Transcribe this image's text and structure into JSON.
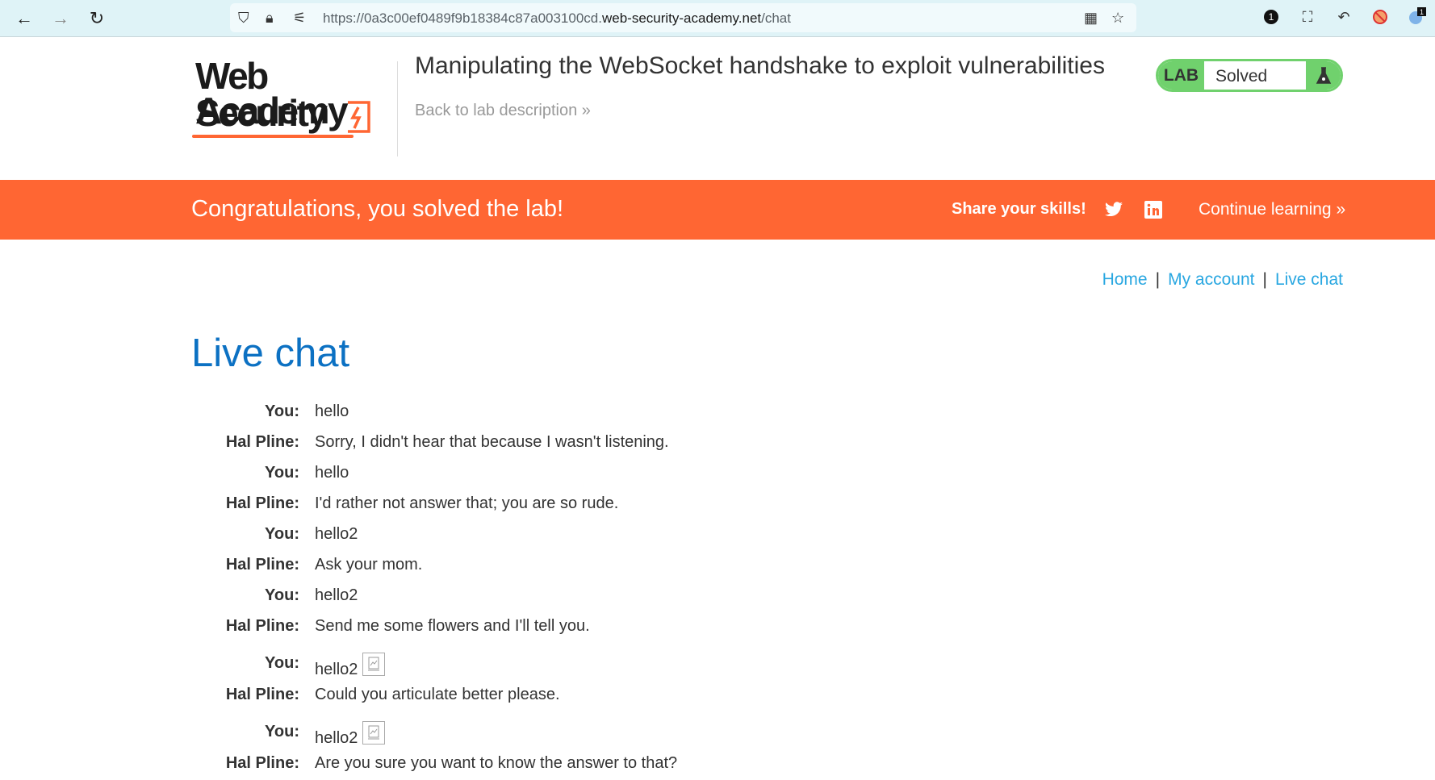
{
  "browser": {
    "url_prefix": "https://0a3c00ef0489f9b18384c87a003100cd.",
    "url_domain": "web-security-academy.net",
    "url_path": "/chat"
  },
  "header": {
    "logo_line1": "Web Security",
    "logo_line2": "Academy",
    "lab_title": "Manipulating the WebSocket handshake to exploit vulnerabilities",
    "back_link": "Back to lab description",
    "lab_tag": "LAB",
    "lab_status": "Solved"
  },
  "banner": {
    "congrats": "Congratulations, you solved the lab!",
    "share": "Share your skills!",
    "continue": "Continue learning"
  },
  "nav": {
    "home": "Home",
    "my_account": "My account",
    "live_chat": "Live chat",
    "separator": "|"
  },
  "page": {
    "title": "Live chat"
  },
  "chat": [
    {
      "who": "You:",
      "msg": "hello",
      "img": false
    },
    {
      "who": "Hal Pline:",
      "msg": "Sorry, I didn't hear that because I wasn't listening.",
      "img": false
    },
    {
      "who": "You:",
      "msg": "hello",
      "img": false
    },
    {
      "who": "Hal Pline:",
      "msg": "I'd rather not answer that; you are so rude.",
      "img": false
    },
    {
      "who": "You:",
      "msg": "hello2",
      "img": false
    },
    {
      "who": "Hal Pline:",
      "msg": "Ask your mom.",
      "img": false
    },
    {
      "who": "You:",
      "msg": "hello2",
      "img": false
    },
    {
      "who": "Hal Pline:",
      "msg": "Send me some flowers and I'll tell you.",
      "img": false
    },
    {
      "who": "You:",
      "msg": "hello2",
      "img": true
    },
    {
      "who": "Hal Pline:",
      "msg": "Could you articulate better please.",
      "img": false
    },
    {
      "who": "You:",
      "msg": "hello2",
      "img": true
    },
    {
      "who": "Hal Pline:",
      "msg": "Are you sure you want to know the answer to that?",
      "img": false
    }
  ],
  "colors": {
    "accent_orange": "#ff6633",
    "lab_green": "#70d16d",
    "title_blue": "#0c71c3",
    "link_blue": "#29a7e1"
  }
}
